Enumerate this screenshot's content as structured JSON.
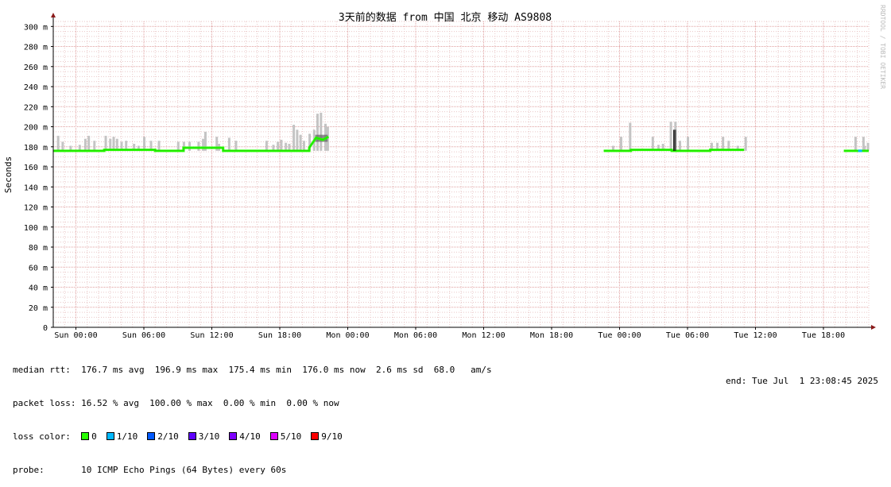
{
  "chart_data": {
    "type": "line",
    "title": "3天前的数据 from 中国 北京 移动 AS9808",
    "ylabel": "Seconds",
    "xlabel": "",
    "watermark": "RRDTOOL / TOBI OETIKER",
    "ylim": [
      0,
      305
    ],
    "y_unit": "ms",
    "y_ticks": [
      0,
      20,
      40,
      60,
      80,
      100,
      120,
      140,
      160,
      180,
      200,
      220,
      240,
      260,
      280,
      300
    ],
    "y_tick_labels": [
      "0",
      "20 m",
      "40 m",
      "60 m",
      "80 m",
      "100 m",
      "120 m",
      "140 m",
      "160 m",
      "180 m",
      "200 m",
      "220 m",
      "240 m",
      "260 m",
      "280 m",
      "300 m"
    ],
    "xlim_hours": [
      -2,
      70
    ],
    "x_ticks_hours": [
      0,
      6,
      12,
      18,
      24,
      30,
      36,
      42,
      48,
      54,
      60,
      66
    ],
    "x_tick_labels": [
      "Sun 00:00",
      "Sun 06:00",
      "Sun 12:00",
      "Sun 18:00",
      "Mon 00:00",
      "Mon 06:00",
      "Mon 12:00",
      "Mon 18:00",
      "Tue 00:00",
      "Tue 06:00",
      "Tue 12:00",
      "Tue 18:00"
    ],
    "grid": true,
    "median_segments": [
      {
        "x": [
          -2,
          2.5,
          2.5,
          7,
          7,
          9.5,
          9.5,
          13,
          13,
          20.6,
          20.6,
          21.2,
          21.8,
          22.3
        ],
        "y": [
          176,
          176,
          177,
          177,
          176,
          176,
          179,
          179,
          176,
          176,
          179,
          189,
          187,
          190
        ],
        "loss": "0"
      },
      {
        "x": [
          46.6,
          49.0,
          49.0,
          52.6,
          52.6,
          56.0,
          56.0,
          59.0
        ],
        "y": [
          176,
          176,
          177,
          177,
          176,
          176,
          177,
          177
        ],
        "loss": "0"
      },
      {
        "x": [
          67.8,
          70
        ],
        "y": [
          176,
          176
        ],
        "loss": "0"
      }
    ],
    "smoke_bars": [
      {
        "x": -1.6,
        "top": 191
      },
      {
        "x": -1.2,
        "top": 185
      },
      {
        "x": -0.5,
        "top": 181
      },
      {
        "x": 0.3,
        "top": 182
      },
      {
        "x": 0.8,
        "top": 188
      },
      {
        "x": 1.1,
        "top": 191
      },
      {
        "x": 1.6,
        "top": 186
      },
      {
        "x": 2.6,
        "top": 191
      },
      {
        "x": 3.0,
        "top": 188
      },
      {
        "x": 3.3,
        "top": 190
      },
      {
        "x": 3.6,
        "top": 188
      },
      {
        "x": 4.0,
        "top": 185
      },
      {
        "x": 4.4,
        "top": 186
      },
      {
        "x": 5.1,
        "top": 183
      },
      {
        "x": 5.5,
        "top": 181
      },
      {
        "x": 6.0,
        "top": 190
      },
      {
        "x": 6.6,
        "top": 186
      },
      {
        "x": 7.3,
        "top": 186
      },
      {
        "x": 9.0,
        "top": 185
      },
      {
        "x": 9.5,
        "top": 185
      },
      {
        "x": 10.0,
        "top": 185
      },
      {
        "x": 10.8,
        "top": 185
      },
      {
        "x": 11.2,
        "top": 188
      },
      {
        "x": 11.4,
        "top": 195
      },
      {
        "x": 12.4,
        "top": 190
      },
      {
        "x": 12.6,
        "top": 183
      },
      {
        "x": 13.5,
        "top": 189
      },
      {
        "x": 14.1,
        "top": 186
      },
      {
        "x": 16.8,
        "top": 186
      },
      {
        "x": 17.4,
        "top": 182
      },
      {
        "x": 17.8,
        "top": 185
      },
      {
        "x": 18.1,
        "top": 187
      },
      {
        "x": 18.5,
        "top": 184
      },
      {
        "x": 18.8,
        "top": 183
      },
      {
        "x": 19.2,
        "top": 202
      },
      {
        "x": 19.5,
        "top": 197
      },
      {
        "x": 19.8,
        "top": 192
      },
      {
        "x": 20.1,
        "top": 186
      },
      {
        "x": 20.6,
        "top": 193
      },
      {
        "x": 21.0,
        "top": 197
      },
      {
        "x": 21.3,
        "top": 213
      },
      {
        "x": 21.6,
        "top": 214
      },
      {
        "x": 22.0,
        "top": 203
      },
      {
        "x": 22.2,
        "top": 200
      },
      {
        "x": 47.4,
        "top": 181
      },
      {
        "x": 48.1,
        "top": 190
      },
      {
        "x": 48.9,
        "top": 204
      },
      {
        "x": 50.9,
        "top": 190
      },
      {
        "x": 51.4,
        "top": 182
      },
      {
        "x": 51.8,
        "top": 183
      },
      {
        "x": 52.5,
        "top": 205
      },
      {
        "x": 52.9,
        "top": 205
      },
      {
        "x": 53.3,
        "top": 186
      },
      {
        "x": 54.0,
        "top": 190
      },
      {
        "x": 56.1,
        "top": 184
      },
      {
        "x": 56.6,
        "top": 184
      },
      {
        "x": 57.1,
        "top": 190
      },
      {
        "x": 57.6,
        "top": 186
      },
      {
        "x": 58.4,
        "top": 181
      },
      {
        "x": 59.1,
        "top": 190
      },
      {
        "x": 68.8,
        "top": 190
      },
      {
        "x": 69.6,
        "top": 181
      },
      {
        "x": 69.9,
        "top": 184
      }
    ],
    "smoke_bars_2": [
      {
        "x": 69.5,
        "top": 190
      },
      {
        "x": 70.3,
        "top": 186
      },
      {
        "x": 70.9,
        "top": 184
      },
      {
        "x": 71.6,
        "top": 185
      }
    ],
    "spike": {
      "x": 52.8,
      "top": 197
    },
    "loss_spot": {
      "x": 69.2,
      "loss": "1/10"
    }
  },
  "stats": {
    "median_rtt_line": "median rtt:  176.7 ms avg  196.9 ms max  175.4 ms min  176.0 ms now  2.6 ms sd  68.0   am/s",
    "packet_loss_line": "packet loss: 16.52 % avg  100.00 % max  0.00 % min  0.00 % now",
    "loss_color_label": "loss color:",
    "probe_line": "probe:       10 ICMP Echo Pings (64 Bytes) every 60s",
    "end_time": "end: Tue Jul  1 23:08:45 2025"
  },
  "loss_legend": [
    {
      "label": "0",
      "color": "#26ff00"
    },
    {
      "label": "1/10",
      "color": "#00b8ff"
    },
    {
      "label": "2/10",
      "color": "#0059ff"
    },
    {
      "label": "3/10",
      "color": "#5e00ff"
    },
    {
      "label": "4/10",
      "color": "#7e00ff"
    },
    {
      "label": "5/10",
      "color": "#dd00ff"
    },
    {
      "label": "9/10",
      "color": "#ff0000"
    }
  ]
}
